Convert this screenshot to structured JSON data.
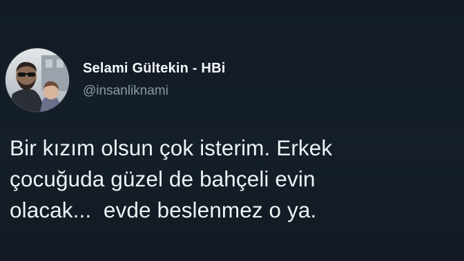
{
  "tweet": {
    "author": {
      "display_name": "Selami Gültekin - HBi",
      "handle": "@insanliknami",
      "avatar_icon": "profile-photo-avatar"
    },
    "text_lines": [
      "Bir kızım olsun çok isterim. Erkek",
      "çocuğuda güzel de bahçeli evin",
      "olacak...  evde beslenmez o ya."
    ]
  },
  "colors": {
    "background": "#141d26",
    "name_text": "#f5f8fa",
    "handle_text": "#8899a6",
    "body_text": "#eef2f5"
  }
}
